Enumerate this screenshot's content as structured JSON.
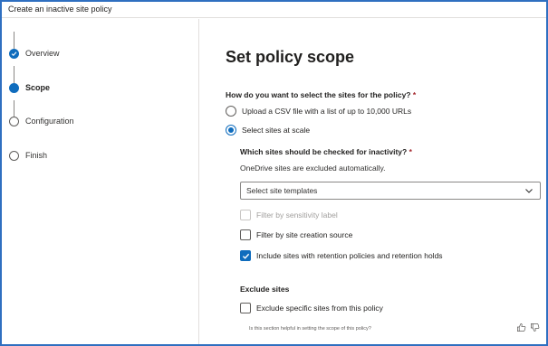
{
  "window": {
    "title": "Create an inactive site policy"
  },
  "steps": [
    {
      "label": "Overview",
      "state": "done"
    },
    {
      "label": "Scope",
      "state": "current"
    },
    {
      "label": "Configuration",
      "state": "pending"
    },
    {
      "label": "Finish",
      "state": "pending"
    }
  ],
  "main": {
    "title": "Set policy scope",
    "question": "How do you want to select the sites for the policy?",
    "required_mark": "*",
    "radio_options": [
      {
        "label": "Upload a CSV file with a list of up to 10,000 URLs",
        "selected": false
      },
      {
        "label": "Select sites at scale",
        "selected": true
      }
    ],
    "sites_question": "Which sites should be checked for inactivity?",
    "sites_note": "OneDrive sites are excluded automatically.",
    "template_dropdown": {
      "placeholder": "Select site templates"
    },
    "checkboxes": [
      {
        "label": "Filter by sensitivity label",
        "checked": false,
        "disabled": true
      },
      {
        "label": "Filter by site creation source",
        "checked": false,
        "disabled": false
      },
      {
        "label": "Include sites with retention policies and retention holds",
        "checked": true,
        "disabled": false
      }
    ],
    "exclude": {
      "title": "Exclude sites",
      "checkbox_label": "Exclude specific sites from this policy",
      "checked": false
    },
    "feedback": {
      "question": "Is this section helpful in setting the scope of this policy?",
      "like_icon": "thumbs-up-icon",
      "dislike_icon": "thumbs-down-icon"
    }
  },
  "colors": {
    "accent": "#0f6cbd",
    "frame": "#2f6fc0",
    "required": "#a4262c"
  }
}
